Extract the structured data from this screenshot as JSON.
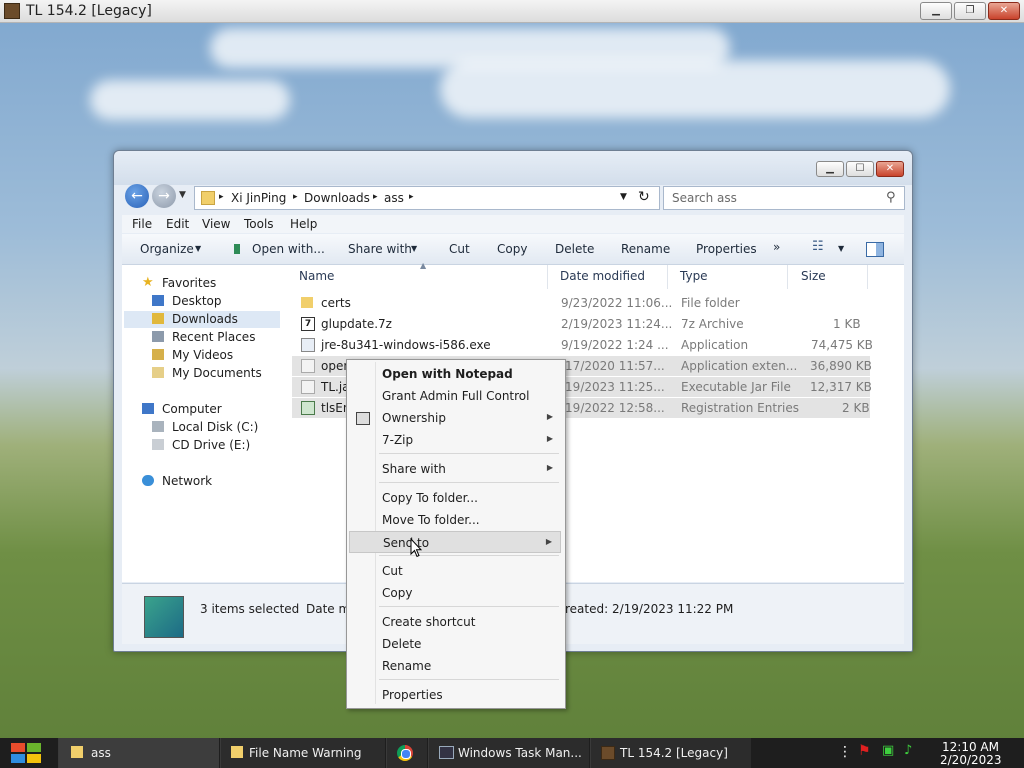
{
  "game_window": {
    "title": "TL 154.2 [Legacy]"
  },
  "explorer": {
    "breadcrumb": [
      "Xi JinPing",
      "Downloads",
      "ass"
    ],
    "search_placeholder": "Search ass",
    "menu": [
      "File",
      "Edit",
      "View",
      "Tools",
      "Help"
    ],
    "commands": [
      "Organize",
      "Open with...",
      "Share with",
      "Cut",
      "Copy",
      "Delete",
      "Rename",
      "Properties",
      "»"
    ],
    "nav": {
      "favorites": "Favorites",
      "favorites_items": [
        "Desktop",
        "Downloads",
        "Recent Places",
        "My Videos",
        "My Documents"
      ],
      "computer": "Computer",
      "computer_items": [
        "Local Disk (C:)",
        "CD Drive (E:)"
      ],
      "network": "Network"
    },
    "columns": [
      "Name",
      "Date modified",
      "Type",
      "Size"
    ],
    "files": [
      {
        "name": "certs",
        "date": "9/23/2022 11:06...",
        "type": "File folder",
        "size": "",
        "selected": false
      },
      {
        "name": "glupdate.7z",
        "date": "2/19/2023 11:24...",
        "type": "7z Archive",
        "size": "1 KB",
        "selected": false
      },
      {
        "name": "jre-8u341-windows-i586.exe",
        "date": "9/19/2022 1:24 ...",
        "type": "Application",
        "size": "74,475 KB",
        "selected": false
      },
      {
        "name": "open",
        "date": "/17/2020 11:57...",
        "type": "Application exten...",
        "size": "36,890 KB",
        "selected": true
      },
      {
        "name": "TL.ja",
        "date": "/19/2023 11:25...",
        "type": "Executable Jar File",
        "size": "12,317 KB",
        "selected": true
      },
      {
        "name": "tlsEn",
        "date": "/19/2022 12:58...",
        "type": "Registration Entries",
        "size": "2 KB",
        "selected": true
      }
    ],
    "details": {
      "selected": "3 items selected",
      "date_label": "Date m",
      "created": "reated:  2/19/2023 11:22 PM"
    }
  },
  "context_menu": {
    "items": [
      "Open with Notepad",
      "Grant Admin Full Control",
      "Ownership",
      "7-Zip",
      "Share with",
      "Copy To folder...",
      "Move To folder...",
      "Send to",
      "Cut",
      "Copy",
      "Create shortcut",
      "Delete",
      "Rename",
      "Properties"
    ]
  },
  "taskbar": {
    "items": [
      "ass",
      "File Name Warning",
      "Windows Task Man...",
      "TL 154.2 [Legacy]"
    ],
    "time": "12:10 AM",
    "date": "2/20/2023"
  }
}
